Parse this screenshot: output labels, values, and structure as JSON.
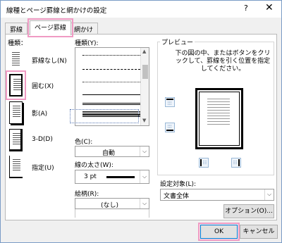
{
  "window": {
    "title": "線種とページ罫線と網かけの設定",
    "help": "?",
    "close": "✕"
  },
  "tabs": [
    "罫線",
    "ページ罫線",
    "網かけ"
  ],
  "kind": {
    "label": "種類：",
    "items": [
      "罫線なし(N)",
      "囲む(X)",
      "影(A)",
      "3-D(D)",
      "指定(U)"
    ],
    "selected": 1
  },
  "style": {
    "label": "種類(Y):"
  },
  "color": {
    "label": "色(C):",
    "value": "自動"
  },
  "width": {
    "label": "線の太さ(W):",
    "value": "3 pt"
  },
  "art": {
    "label": "絵柄(R):",
    "value": "(なし)"
  },
  "preview": {
    "title": "プレビュー",
    "desc": "下の図の中、またはボタンをクリックして、罫線を引く位置を指定してください。"
  },
  "apply": {
    "label": "設定対象(L):",
    "value": "文書全体"
  },
  "buttons": {
    "options": "オプション(O)...",
    "ok": "OK",
    "cancel": "キャンセル"
  },
  "colors": {
    "highlight": "#f09bc4",
    "accent": "#0078d7"
  }
}
